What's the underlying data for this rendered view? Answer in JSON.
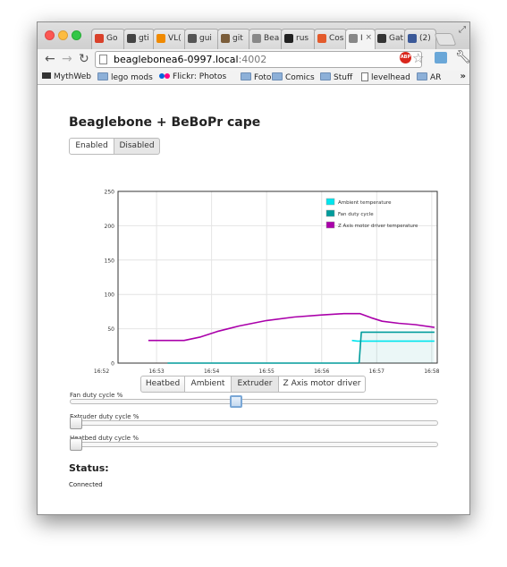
{
  "browser": {
    "tabs": [
      {
        "label": "Go",
        "icon": "google-icon",
        "color": "#d9412b"
      },
      {
        "label": "gti",
        "icon": "grid-icon",
        "color": "#444444"
      },
      {
        "label": "VL(",
        "icon": "vlc-icon",
        "color": "#f08a00"
      },
      {
        "label": "gui",
        "icon": "dots-icon",
        "color": "#555555"
      },
      {
        "label": "git",
        "icon": "git-icon",
        "color": "#7b5d3a"
      },
      {
        "label": "Bea",
        "icon": "page-icon",
        "color": "#888888"
      },
      {
        "label": "rus",
        "icon": "github-icon",
        "color": "#222222"
      },
      {
        "label": "Cos",
        "icon": "swirl-icon",
        "color": "#e35a2b"
      },
      {
        "label": "I",
        "icon": "page-icon",
        "color": "#888888"
      },
      {
        "label": "Gat",
        "icon": "terminal-icon",
        "color": "#333333"
      },
      {
        "label": "(2)",
        "icon": "facebook-icon",
        "color": "#3b5998"
      }
    ],
    "url_host": "beaglebonea6-0997.local",
    "url_port": ":4002",
    "abp_label": "ABP",
    "bookmarks": [
      {
        "label": "MythWeb",
        "icon": "mythweb-icon"
      },
      {
        "label": "lego mods",
        "icon": "folder-icon"
      },
      {
        "label": "Flickr: Photos",
        "icon": "flickr-icon"
      },
      {
        "label": "Foto",
        "icon": "folder-icon"
      },
      {
        "label": "Comics",
        "icon": "folder-icon"
      },
      {
        "label": "Stuff",
        "icon": "folder-icon"
      },
      {
        "label": "levelhead",
        "icon": "page-icon"
      },
      {
        "label": "AR",
        "icon": "folder-icon"
      }
    ],
    "more_label": "»"
  },
  "page": {
    "title": "Beaglebone + BeBoPr cape",
    "toggle": {
      "enabled_label": "Enabled",
      "disabled_label": "Disabled",
      "selected": "Enabled"
    },
    "chart_tabs": [
      {
        "label": "Heatbed",
        "selected": false
      },
      {
        "label": "Ambient",
        "selected": true
      },
      {
        "label": "Extruder",
        "selected": false
      },
      {
        "label": "Z Axis motor driver",
        "selected": true
      }
    ],
    "sliders": [
      {
        "label": "Fan duty cycle %",
        "value_fraction": 0.45,
        "focused": true
      },
      {
        "label": "Extruder duty cycle %",
        "value_fraction": 0.0,
        "focused": false
      },
      {
        "label": "Heatbed duty cycle %",
        "value_fraction": 0.0,
        "focused": false
      }
    ],
    "status_heading": "Status:",
    "status_value": "Connected"
  },
  "chart_data": {
    "type": "line",
    "title": "",
    "xlabel": "",
    "ylabel": "",
    "xlim": [
      52.3,
      58.1
    ],
    "ylim": [
      0,
      250
    ],
    "yticks": [
      0,
      50,
      100,
      150,
      200,
      250
    ],
    "xticks": [
      {
        "value": 52,
        "label": "16:52"
      },
      {
        "value": 53,
        "label": "16:53"
      },
      {
        "value": 54,
        "label": "16:54"
      },
      {
        "value": 55,
        "label": "16:55"
      },
      {
        "value": 56,
        "label": "16:56"
      },
      {
        "value": 57,
        "label": "16:57"
      },
      {
        "value": 58,
        "label": "16:58"
      }
    ],
    "grid": true,
    "legend_position": "top-right",
    "series": [
      {
        "name": "Ambient temperature",
        "color": "#00e5ee",
        "x": [
          56.55,
          56.65,
          57.0,
          57.5,
          58.05
        ],
        "y": [
          33,
          32,
          32,
          32,
          32
        ]
      },
      {
        "name": "Fan duty cycle",
        "color": "#009c9c",
        "x": [
          53.2,
          56.65,
          56.68,
          56.72,
          56.8,
          57.0,
          57.5,
          58.05
        ],
        "y": [
          0,
          0,
          0,
          45,
          45,
          45,
          45,
          45
        ]
      },
      {
        "name": "Z Axis motor driver temperature",
        "color": "#aa00aa",
        "x": [
          52.85,
          53.2,
          53.5,
          53.8,
          54.1,
          54.5,
          55.0,
          55.5,
          56.0,
          56.4,
          56.7,
          56.9,
          57.1,
          57.4,
          57.7,
          58.05
        ],
        "y": [
          33,
          33,
          33,
          38,
          46,
          54,
          62,
          67,
          70,
          72,
          72,
          66,
          61,
          58,
          56,
          52
        ]
      }
    ]
  }
}
